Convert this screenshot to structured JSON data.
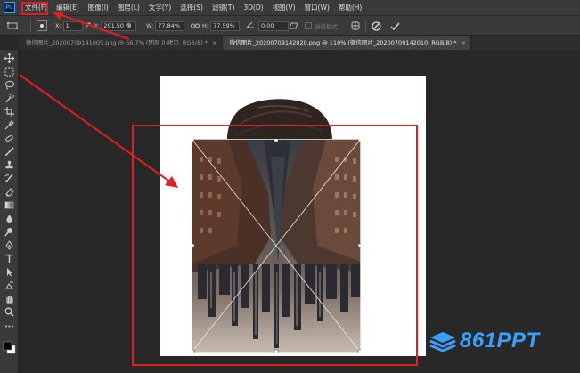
{
  "app": {
    "logo_text": "Ps"
  },
  "menu": {
    "items": [
      {
        "label": "文件(F)"
      },
      {
        "label": "编辑(E)"
      },
      {
        "label": "图像(I)"
      },
      {
        "label": "图层(L)"
      },
      {
        "label": "文字(Y)"
      },
      {
        "label": "选择(S)"
      },
      {
        "label": "滤镜(T)"
      },
      {
        "label": "3D(D)"
      },
      {
        "label": "视图(V)"
      },
      {
        "label": "窗口(W)"
      },
      {
        "label": "帮助(H)"
      }
    ]
  },
  "options": {
    "x_label": "X:",
    "x_value": "1",
    "y_label": "Y:",
    "y_value": "291.50 像",
    "w_label": "W:",
    "w_value": "77.84%",
    "h_label": "H:",
    "h_value": "77.59%",
    "angle_value": "0.00",
    "interp_label": "插值模式"
  },
  "tabs": [
    {
      "label": "微信图片_20200709141005.png @ 66.7% (图层 0 拷贝, RGB/8) *",
      "active": false
    },
    {
      "label": "微信图片_20200709142020.png @ 110% (微信图片_20200709142010, RGB/8) *",
      "active": true
    }
  ],
  "watermark": {
    "text": "861PPT",
    "color": "#3aa0ff"
  },
  "colors": {
    "annotation": "#e02020",
    "ps_blue": "#31a8ff"
  },
  "tools": [
    "move-tool-icon",
    "marquee-tool-icon",
    "lasso-tool-icon",
    "quick-select-tool-icon",
    "crop-tool-icon",
    "eyedropper-tool-icon",
    "healing-brush-tool-icon",
    "brush-tool-icon",
    "stamp-tool-icon",
    "history-brush-tool-icon",
    "eraser-tool-icon",
    "gradient-tool-icon",
    "blur-tool-icon",
    "dodge-tool-icon",
    "pen-tool-icon",
    "type-tool-icon",
    "path-select-tool-icon",
    "shape-tool-icon",
    "hand-tool-icon",
    "zoom-tool-icon",
    "more-tools-icon"
  ]
}
